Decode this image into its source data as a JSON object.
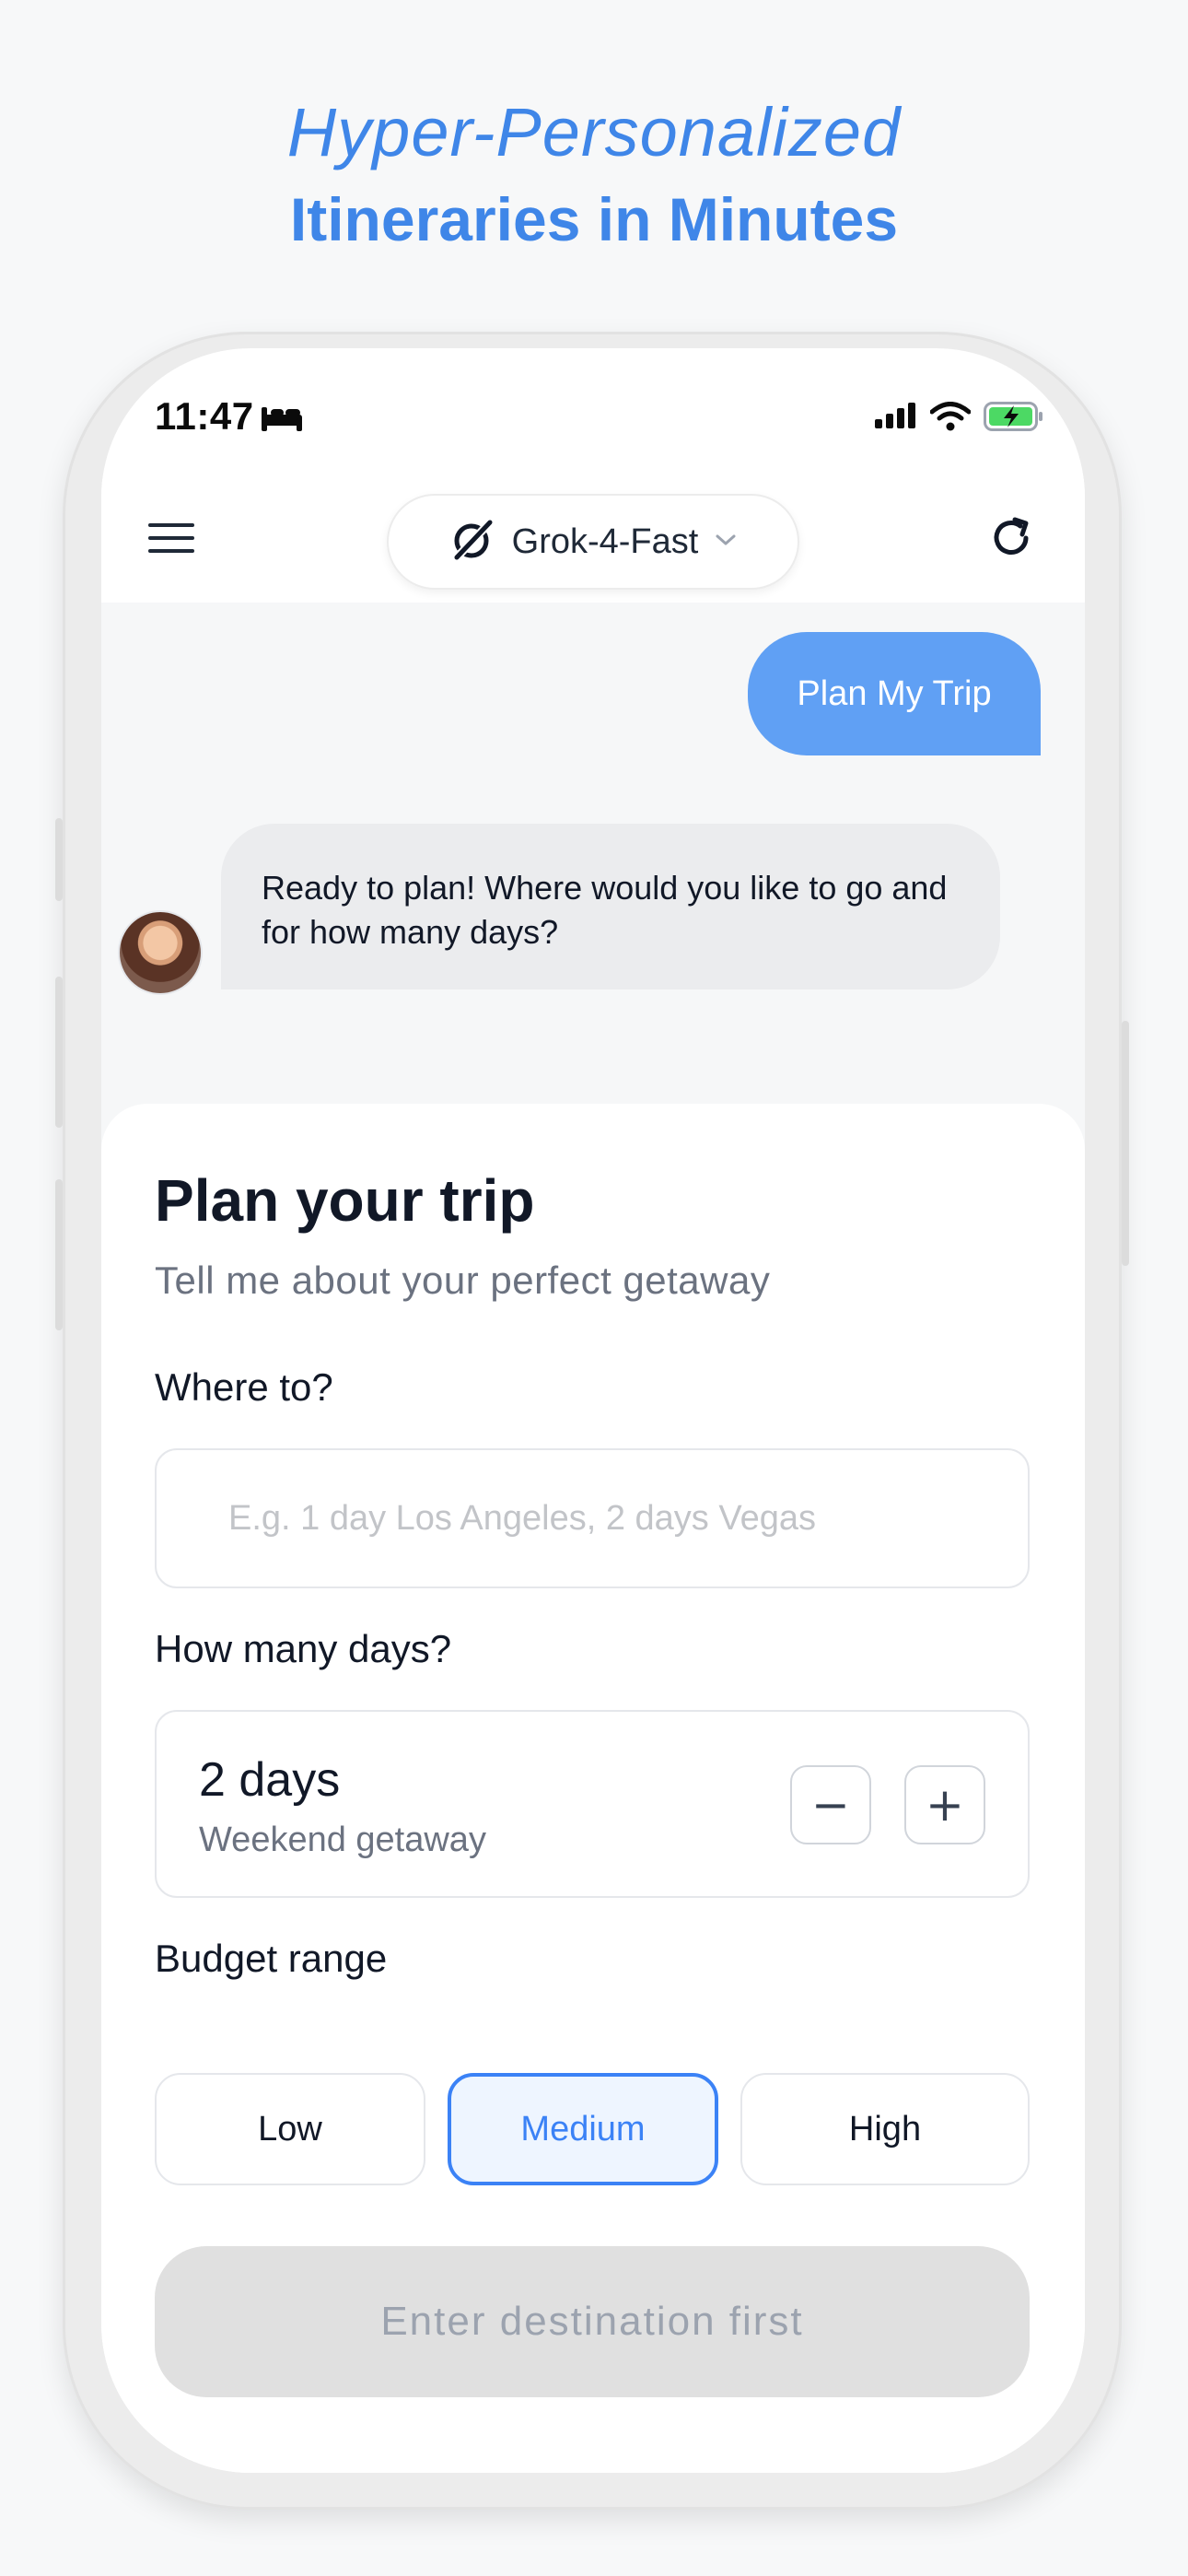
{
  "headline": {
    "line1": "Hyper-Personalized",
    "line2": "Itineraries in Minutes"
  },
  "status_bar": {
    "time": "11:47"
  },
  "nav": {
    "model_name": "Grok-4-Fast",
    "icons": [
      "menu-icon",
      "grok-logo-icon",
      "chevron-down-icon",
      "refresh-icon"
    ]
  },
  "chat": {
    "user_message": "Plan My Trip",
    "bot_message": "Ready to plan! Where would you like to go and for how many days?"
  },
  "form": {
    "title": "Plan your trip",
    "subtitle": "Tell me about your perfect getaway",
    "where_label": "Where to?",
    "where_value": "",
    "where_placeholder": "E.g. 1 day Los Angeles, 2 days Vegas",
    "days_label": "How many days?",
    "days_value": "2 days",
    "days_description": "Weekend getaway",
    "decrement_label": "−",
    "increment_label": "+",
    "budget_label": "Budget range",
    "budget_options": [
      "Low",
      "Medium",
      "High"
    ],
    "budget_selected": "Medium",
    "submit_label": "Enter destination first"
  },
  "colors": {
    "accent": "#3f86e8",
    "user_bubble": "#60a0f4",
    "bot_bubble": "#ebecee",
    "selected_border": "#3b82f6",
    "disabled_button": "#e0e0e0",
    "battery_green": "#4cd964"
  }
}
